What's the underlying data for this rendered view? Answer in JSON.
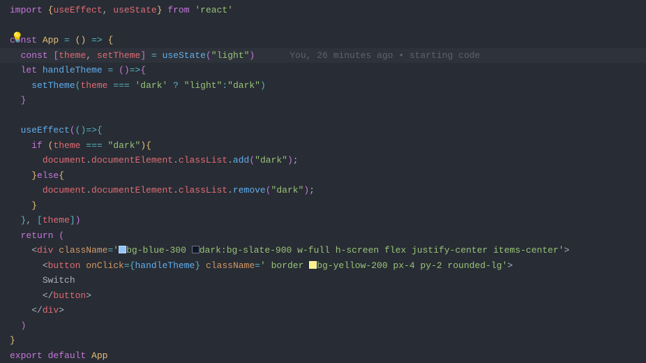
{
  "blame": "You, 26 minutes ago • starting code",
  "code": {
    "l1": {
      "import": "import",
      "lb": "{",
      "useEffect": "useEffect",
      "c": ",",
      "useState": "useState",
      "rb": "}",
      "from": "from",
      "react": "'react'"
    },
    "l3": {
      "const": "const",
      "App": "App",
      "eq": "=",
      "lp": "(",
      "rp": ")",
      "arrow": "=>",
      "lb": "{"
    },
    "l4": {
      "const": "const",
      "lb": "[",
      "theme": "theme",
      "c": ",",
      "setTheme": "setTheme",
      "rb": "]",
      "eq": "=",
      "useState": "useState",
      "lp": "(",
      "light": "\"light\"",
      "rp": ")"
    },
    "l5": {
      "let": "let",
      "handleTheme": "handleTheme",
      "eq": "=",
      "lp": "(",
      "rp": ")",
      "arrow": "=>",
      "lb": "{"
    },
    "l6": {
      "setTheme": "setTheme",
      "lp": "(",
      "theme": "theme",
      "eqeq": "===",
      "dark": "'dark'",
      "q": "?",
      "light": "\"light\"",
      "colon": ":",
      "dark2": "\"dark\"",
      "rp": ")"
    },
    "l7": {
      "rb": "}"
    },
    "l9": {
      "useEffect": "useEffect",
      "lp": "(",
      "lp2": "(",
      "rp2": ")",
      "arrow": "=>",
      "lb": "{"
    },
    "l10": {
      "if": "if",
      "lp": "(",
      "theme": "theme",
      "eqeq": "===",
      "dark": "\"dark\"",
      "rp": ")",
      "lb": "{"
    },
    "l11": {
      "document": "document",
      "d1": ".",
      "documentElement": "documentElement",
      "d2": ".",
      "classList": "classList",
      "d3": ".",
      "add": "add",
      "lp": "(",
      "dark": "\"dark\"",
      "rp": ")",
      "sc": ";"
    },
    "l12": {
      "rb": "}",
      "else": "else",
      "lb": "{"
    },
    "l13": {
      "document": "document",
      "d1": ".",
      "documentElement": "documentElement",
      "d2": ".",
      "classList": "classList",
      "d3": ".",
      "remove": "remove",
      "lp": "(",
      "dark": "\"dark\"",
      "rp": ")",
      "sc": ";"
    },
    "l14": {
      "rb": "}"
    },
    "l15": {
      "rb": "}",
      "c": ",",
      "lbr": "[",
      "theme": "theme",
      "rbr": "]",
      "rp": ")"
    },
    "l16": {
      "return": "return",
      "lp": "("
    },
    "l17": {
      "lt": "<",
      "div": "div",
      "className": "className",
      "eq": "=",
      "q1": "'",
      "bgblue": "bg-blue-300 ",
      "darkbg": "dark:bg-slate-900 ",
      "rest": "w-full h-screen flex justify-center items-center",
      "q2": "'",
      "gt": ">"
    },
    "l18": {
      "lt": "<",
      "button": "button",
      "onClick": "onClick",
      "eq": "=",
      "lb": "{",
      "handleTheme": "handleTheme",
      "rb": "}",
      "className": "className",
      "eq2": "=",
      "q1": "'",
      "border": " border ",
      "bgyellow": "bg-yellow-200 ",
      "rest": "px-4 py-2 rounded-lg",
      "q2": "'",
      "gt": ">"
    },
    "l19": {
      "text": "Switch"
    },
    "l20": {
      "lt": "</",
      "button": "button",
      "gt": ">"
    },
    "l21": {
      "lt": "</",
      "div": "div",
      "gt": ">"
    },
    "l22": {
      "rp": ")"
    },
    "l23": {
      "rb": "}"
    },
    "l24": {
      "export": "export",
      "default": "default",
      "App": "App"
    }
  }
}
